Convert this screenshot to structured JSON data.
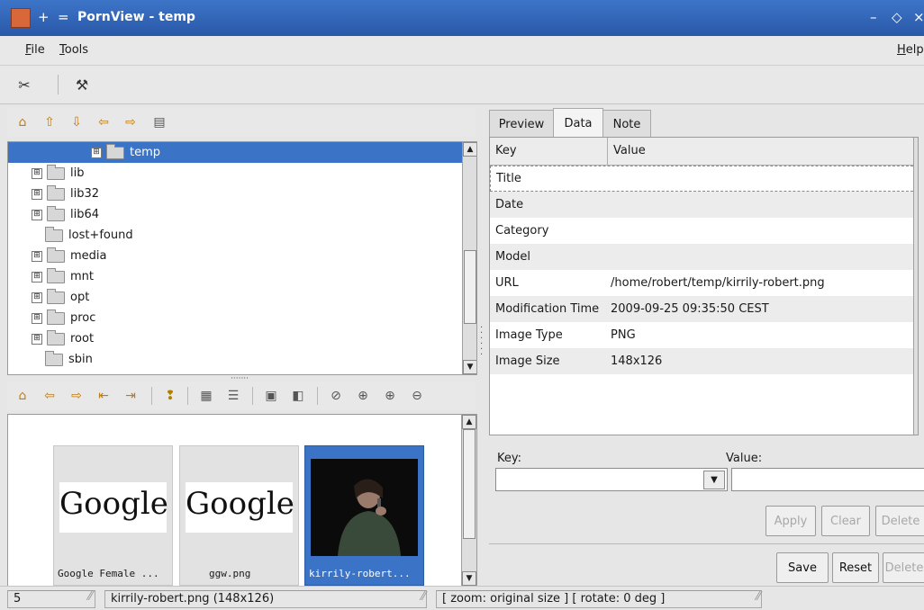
{
  "window": {
    "title": "PornView - temp",
    "pin": "+",
    "shade": "=",
    "min": "–",
    "max": "◇",
    "close": "×"
  },
  "menu": {
    "file": {
      "mnemonic": "F",
      "rest": "ile"
    },
    "tools": {
      "mnemonic": "T",
      "rest": "ools"
    },
    "help": {
      "mnemonic": "H",
      "rest": "elp"
    }
  },
  "tree": {
    "items": [
      {
        "label": "temp",
        "expander": "⊞",
        "selected": true
      },
      {
        "label": "lib",
        "expander": "⊞"
      },
      {
        "label": "lib32",
        "expander": "⊞"
      },
      {
        "label": "lib64",
        "expander": "⊞"
      },
      {
        "label": "lost+found",
        "expander": ""
      },
      {
        "label": "media",
        "expander": "⊞"
      },
      {
        "label": "mnt",
        "expander": "⊞"
      },
      {
        "label": "opt",
        "expander": "⊞"
      },
      {
        "label": "proc",
        "expander": "⊞"
      },
      {
        "label": "root",
        "expander": "⊞"
      },
      {
        "label": "sbin",
        "expander": ""
      }
    ]
  },
  "thumbs": [
    {
      "caption": "Google Female ...",
      "logo": "Google"
    },
    {
      "caption": "ggw.png",
      "logo": "Google"
    },
    {
      "caption": "kirrily-robert...",
      "selected": true
    }
  ],
  "tabs": [
    {
      "label": "Preview"
    },
    {
      "label": "Data",
      "active": true
    },
    {
      "label": "Note"
    }
  ],
  "table": {
    "col_key": "Key",
    "col_value": "Value",
    "rows": [
      {
        "key": "Title",
        "value": ""
      },
      {
        "key": "Date",
        "value": ""
      },
      {
        "key": "Category",
        "value": ""
      },
      {
        "key": "Model",
        "value": ""
      },
      {
        "key": "URL",
        "value": "/home/robert/temp/kirrily-robert.png"
      },
      {
        "key": "Modification Time",
        "value": "2009-09-25 09:35:50 CEST"
      },
      {
        "key": "Image Type",
        "value": "PNG"
      },
      {
        "key": "Image Size",
        "value": "148x126"
      }
    ]
  },
  "editor": {
    "key_label": "Key:",
    "value_label": "Value:",
    "apply": "Apply",
    "clear": "Clear",
    "delete": "Delete",
    "save": "Save",
    "reset": "Reset",
    "delete2": "Delete"
  },
  "status": {
    "count": "5",
    "file": "kirrily-robert.png (148x126)",
    "zoom": "[ zoom: original size ] [ rotate: 0 deg ]"
  },
  "colors": {
    "selection": "#3b73c6",
    "titlebar": "#2f62b4"
  }
}
